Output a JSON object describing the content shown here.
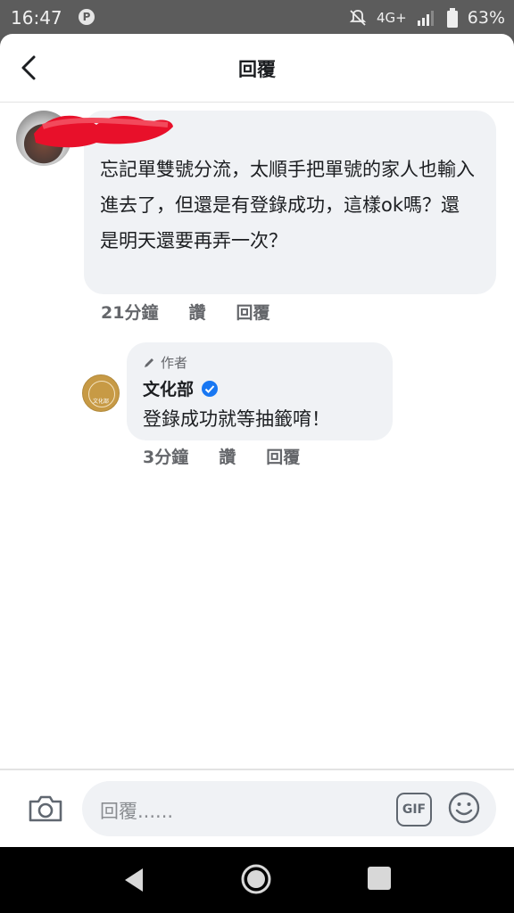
{
  "status_bar": {
    "time": "16:47",
    "parking_badge": "P",
    "network": "4G+",
    "battery_pct": "63%"
  },
  "header": {
    "title": "回覆"
  },
  "comment": {
    "text": "忘記單雙號分流，太順手把單號的家人也輸入進去了，但還是有登錄成功，這樣ok嗎？還是明天還要再弄一次？",
    "time": "21分鐘",
    "like_label": "讚",
    "reply_label": "回覆"
  },
  "reply": {
    "author_badge": "作者",
    "name": "文化部",
    "avatar_text": "文化部",
    "text": "登錄成功就等抽籤唷！",
    "time": "3分鐘",
    "like_label": "讚",
    "reply_label": "回覆"
  },
  "composer": {
    "placeholder": "回覆......",
    "gif_label": "GIF"
  },
  "colors": {
    "bubble": "#f0f2f5",
    "meta_text": "#65676b",
    "verified": "#1877f2",
    "redaction": "#e8102a"
  }
}
